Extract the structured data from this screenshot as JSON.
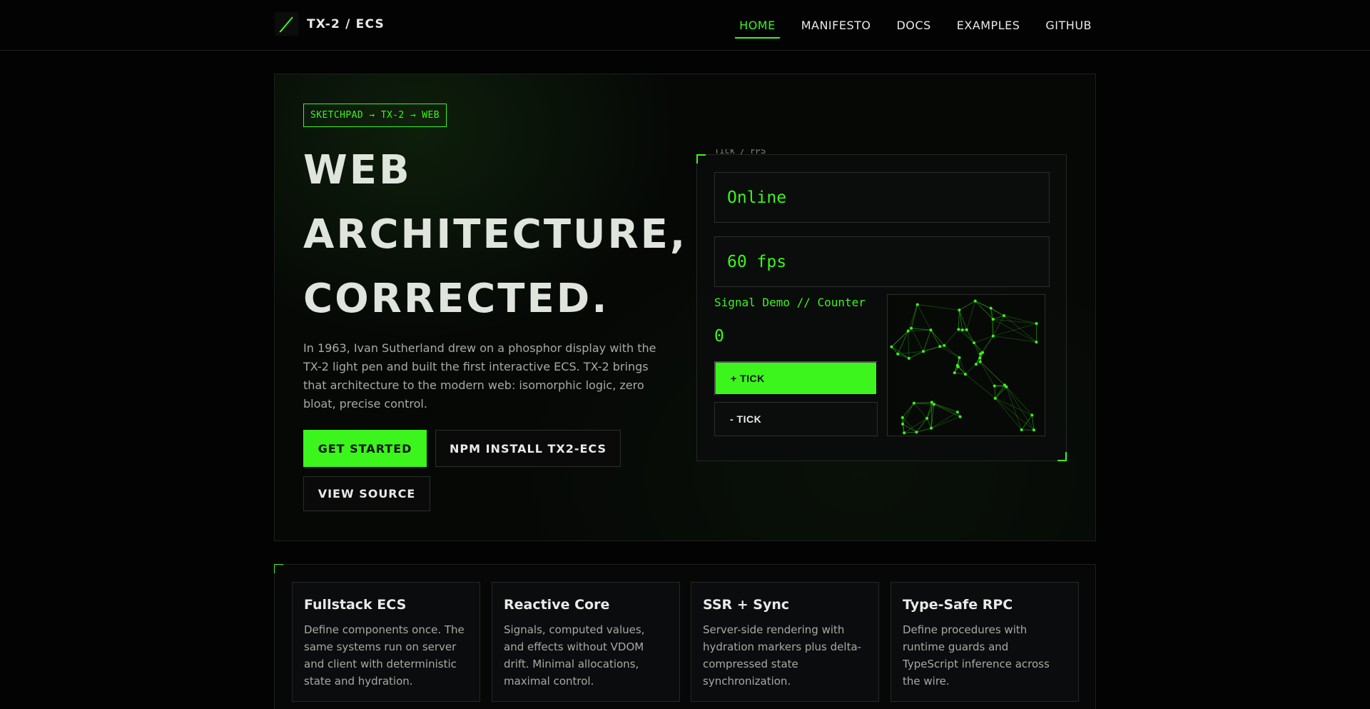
{
  "brand": {
    "name": "TX-2 / ECS",
    "icon": "light-pen-icon",
    "accent": "#3cf51c"
  },
  "nav": {
    "items": [
      {
        "label": "HOME",
        "active": true
      },
      {
        "label": "MANIFESTO",
        "active": false
      },
      {
        "label": "DOCS",
        "active": false
      },
      {
        "label": "EXAMPLES",
        "active": false
      },
      {
        "label": "GITHUB",
        "active": false
      }
    ]
  },
  "hero": {
    "tag": "SKETCHPAD → TX-2 → WEB",
    "headline": [
      "WEB",
      "ARCHITECTURE,",
      "CORRECTED."
    ],
    "lead": "In 1963, Ivan Sutherland drew on a phosphor display with the TX-2 light pen and built the first interactive ECS. TX-2 brings that architecture to the modern web: isomorphic logic, zero bloat, precise control.",
    "buttons": {
      "get_started": "GET STARTED",
      "npm": "NPM INSTALL TX2-ECS",
      "view_source": "VIEW SOURCE"
    }
  },
  "demo": {
    "panel_title": "Tick / FPS",
    "status": "Online",
    "fps": "60 fps",
    "label": "Signal Demo // Counter",
    "counter": "0",
    "plus_label": "+ TICK",
    "minus_label": "- TICK"
  },
  "features": [
    {
      "title": "Fullstack ECS",
      "text": "Define components once. The same systems run on server and client with deterministic state and hydration."
    },
    {
      "title": "Reactive Core",
      "text": "Signals, computed values, and effects without VDOM drift. Minimal allocations, maximal control."
    },
    {
      "title": "SSR + Sync",
      "text": "Server-side rendering with hydration markers plus delta-compressed state synchronization."
    },
    {
      "title": "Type-Safe RPC",
      "text": "Define procedures with runtime guards and TypeScript inference across the wire."
    }
  ]
}
